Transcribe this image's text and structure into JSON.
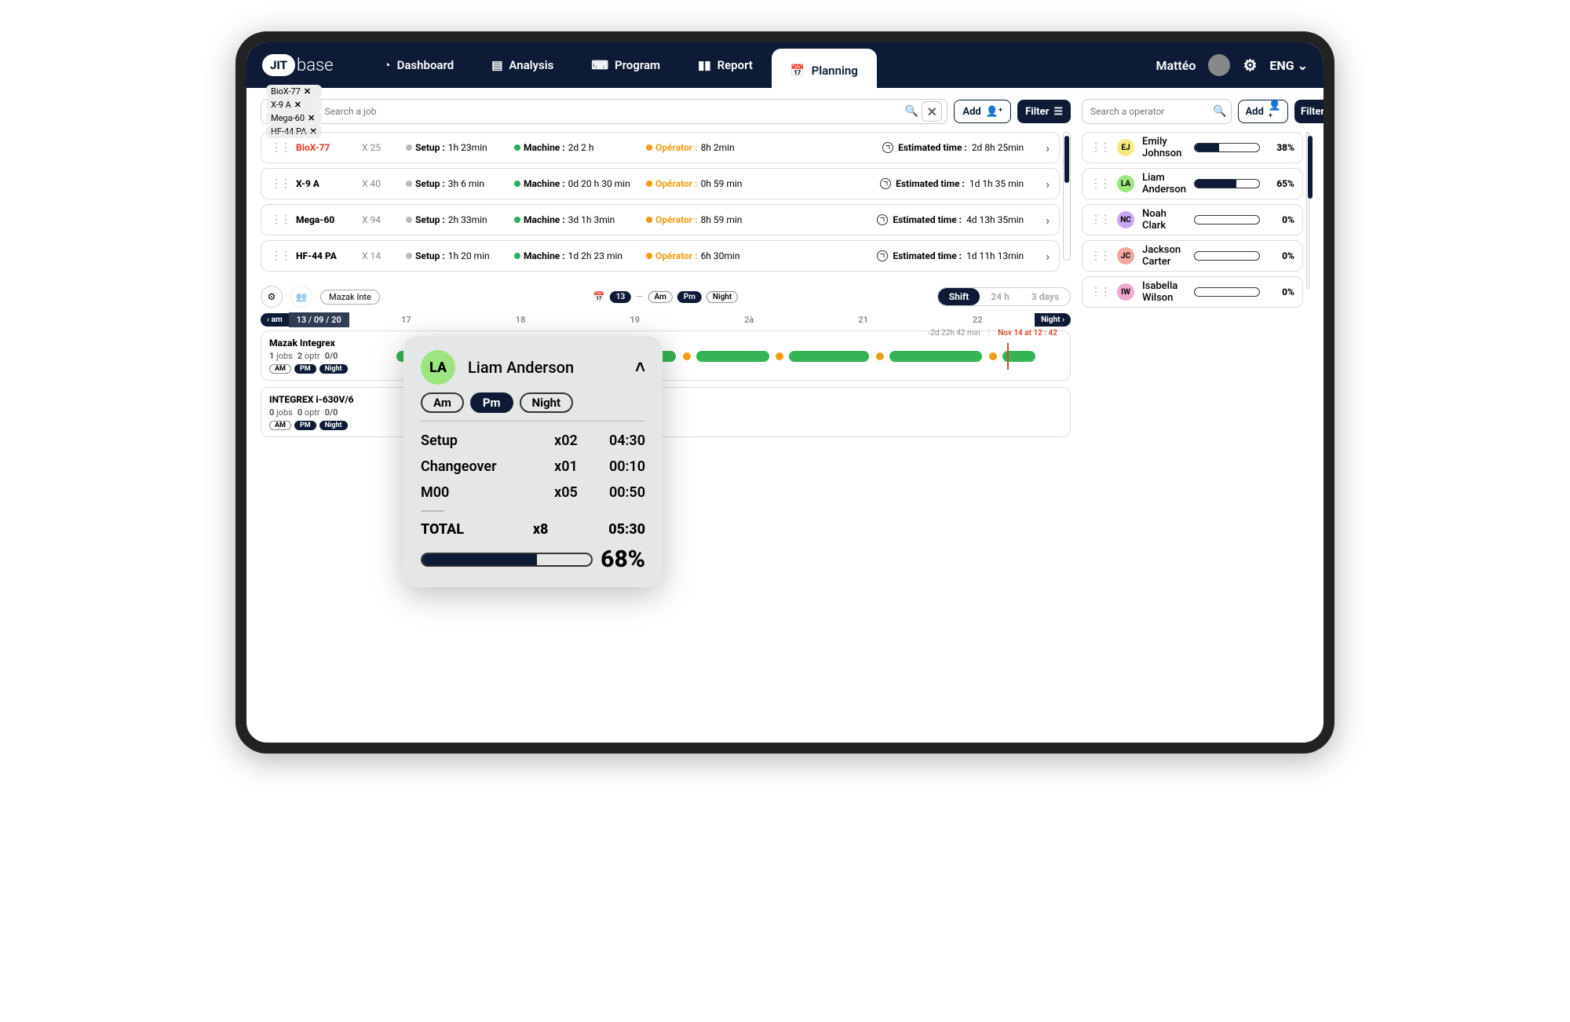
{
  "brand": {
    "bold": "JIT",
    "light": "base"
  },
  "nav": {
    "dashboard": "Dashboard",
    "analysis": "Analysis",
    "program": "Program",
    "report": "Report",
    "planning": "Planning"
  },
  "user": {
    "name": "Mattéo",
    "lang": "ENG"
  },
  "jobs_filter": {
    "chips": [
      "BioX-77",
      "X-9 A",
      "Mega-60",
      "HF-44 PA"
    ],
    "placeholder": "Search a job",
    "add": "Add",
    "filter": "Filter"
  },
  "ops_filter": {
    "placeholder": "Search a operator",
    "add": "Add",
    "filter": "Filter"
  },
  "labels": {
    "setup": "Setup :",
    "machine": "Machine :",
    "operator": "Opérator :",
    "est": "Estimated time :"
  },
  "jobs": [
    {
      "name": "BioX-77",
      "red": true,
      "batch": "X 25",
      "setup": "1h 23min",
      "machine": "2d 2 h",
      "operator": "8h 2min",
      "est": "2d 8h 25min"
    },
    {
      "name": "X-9 A",
      "batch": "X 40",
      "setup": "3h 6 min",
      "machine": "0d 20 h 30 min",
      "operator": "0h 59 min",
      "est": "1d 1h 35 min"
    },
    {
      "name": "Mega-60",
      "batch": "X 94",
      "setup": "2h  33min",
      "machine": "3d 1h 3min",
      "operator": "8h 59 min",
      "est": "4d 13h 35min"
    },
    {
      "name": "HF-44 PA",
      "batch": "X 14",
      "setup": "1h 20 min",
      "machine": "1d 2h 23 min",
      "operator": "6h 30min",
      "est": "1d 11h 13min"
    }
  ],
  "operators": [
    {
      "init": "EJ",
      "name": "Emily Johnson",
      "pct": 38,
      "color": "#f5e97d"
    },
    {
      "init": "LA",
      "name": "Liam Anderson",
      "pct": 65,
      "color": "#9de57f"
    },
    {
      "init": "NC",
      "name": "Noah Clark",
      "pct": 0,
      "color": "#c9a8f0"
    },
    {
      "init": "JC",
      "name": "Jackson Carter",
      "pct": 0,
      "color": "#f2a7a0"
    },
    {
      "init": "IW",
      "name": "Isabella Wilson",
      "pct": 0,
      "color": "#f0a8d2"
    }
  ],
  "timeline": {
    "machine_chip": "Mazak Inte",
    "date_badge": "13",
    "shifts": {
      "am": "Am",
      "pm": "Pm",
      "night": "Night"
    },
    "views": {
      "shift": "Shift",
      "h24": "24 h",
      "d3": "3 days"
    },
    "nav_left": "‹ am",
    "date": "13 / 09 / 20",
    "nav_right": "Night ›",
    "hours": [
      "17",
      "18",
      "19",
      "2à",
      "21",
      "22"
    ],
    "delta": "-2d 22h  42 min",
    "timestamp": "Nov 14 at 12 : 42"
  },
  "machines": [
    {
      "name": "Mazak Integrex",
      "jobs": "1",
      "optr": "2",
      "count": "0/0"
    },
    {
      "name": "INTEGREX i-630V/6",
      "jobs": "0",
      "optr": "0",
      "count": "0/0"
    }
  ],
  "machine_labels": {
    "jobs": "jobs",
    "optr": "optr",
    "am": "AM",
    "pm": "PM",
    "night": "Night"
  },
  "popup": {
    "init": "LA",
    "name": "Liam Anderson",
    "shifts": {
      "am": "Am",
      "pm": "Pm",
      "night": "Night"
    },
    "rows": [
      {
        "label": "Setup",
        "count": "x02",
        "time": "04:30"
      },
      {
        "label": "Changeover",
        "count": "x01",
        "time": "00:10"
      },
      {
        "label": "M00",
        "count": "x05",
        "time": "00:50"
      }
    ],
    "total": {
      "label": "TOTAL",
      "count": "x8",
      "time": "05:30"
    },
    "pct": "68%"
  }
}
